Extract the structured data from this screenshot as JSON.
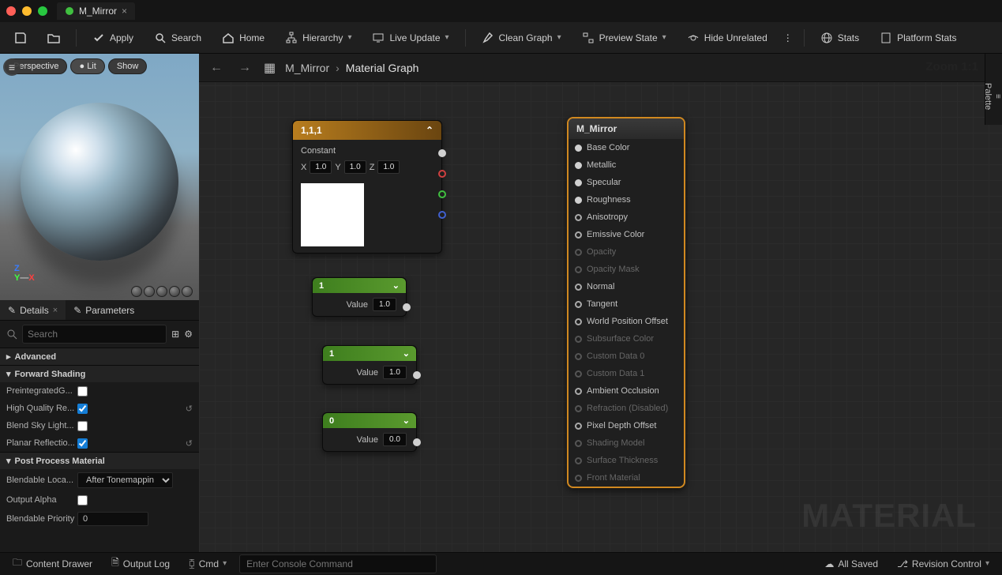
{
  "tab_title": "M_Mirror",
  "toolbar": {
    "apply": "Apply",
    "search": "Search",
    "home": "Home",
    "hierarchy": "Hierarchy",
    "live_update": "Live Update",
    "clean_graph": "Clean Graph",
    "preview_state": "Preview State",
    "hide_unrelated": "Hide Unrelated",
    "stats": "Stats",
    "platform_stats": "Platform Stats"
  },
  "preview": {
    "perspective": "Perspective",
    "lit": "Lit",
    "show": "Show",
    "axis_z": "Z",
    "axis_x": "X"
  },
  "details": {
    "tab_details": "Details",
    "tab_parameters": "Parameters",
    "search_placeholder": "Search",
    "cat_advanced": "Advanced",
    "cat_forward": "Forward Shading",
    "cat_postprocess": "Post Process Material",
    "props": {
      "preintegrated": "PreintegratedG...",
      "hq_reflections": "High Quality Re...",
      "blend_sky": "Blend Sky Light...",
      "planar_refl": "Planar Reflectio...",
      "blendable_loc": "Blendable Loca...",
      "blendable_loc_val": "After Tonemappin",
      "output_alpha": "Output Alpha",
      "blendable_priority": "Blendable Priority",
      "blendable_priority_val": "0"
    }
  },
  "graph": {
    "breadcrumb_root": "M_Mirror",
    "breadcrumb_current": "Material Graph",
    "zoom": "Zoom 1:1",
    "palette": "Palette",
    "watermark": "MATERIAL",
    "result": {
      "title": "M_Mirror",
      "pins": [
        {
          "label": "Base Color",
          "filled": true,
          "enabled": true
        },
        {
          "label": "Metallic",
          "filled": true,
          "enabled": true
        },
        {
          "label": "Specular",
          "filled": true,
          "enabled": true
        },
        {
          "label": "Roughness",
          "filled": true,
          "enabled": true
        },
        {
          "label": "Anisotropy",
          "filled": false,
          "enabled": true
        },
        {
          "label": "Emissive Color",
          "filled": false,
          "enabled": true
        },
        {
          "label": "Opacity",
          "filled": false,
          "enabled": false
        },
        {
          "label": "Opacity Mask",
          "filled": false,
          "enabled": false
        },
        {
          "label": "Normal",
          "filled": false,
          "enabled": true
        },
        {
          "label": "Tangent",
          "filled": false,
          "enabled": true
        },
        {
          "label": "World Position Offset",
          "filled": false,
          "enabled": true
        },
        {
          "label": "Subsurface Color",
          "filled": false,
          "enabled": false
        },
        {
          "label": "Custom Data 0",
          "filled": false,
          "enabled": false
        },
        {
          "label": "Custom Data 1",
          "filled": false,
          "enabled": false
        },
        {
          "label": "Ambient Occlusion",
          "filled": false,
          "enabled": true
        },
        {
          "label": "Refraction (Disabled)",
          "filled": false,
          "enabled": false
        },
        {
          "label": "Pixel Depth Offset",
          "filled": false,
          "enabled": true
        },
        {
          "label": "Shading Model",
          "filled": false,
          "enabled": false
        },
        {
          "label": "Surface Thickness",
          "filled": false,
          "enabled": false
        },
        {
          "label": "Front Material",
          "filled": false,
          "enabled": false
        }
      ]
    },
    "const_node": {
      "title": "1,1,1",
      "label": "Constant",
      "x": "1.0",
      "y": "1.0",
      "z": "1.0"
    },
    "scalar1": {
      "title": "1",
      "value_label": "Value",
      "value": "1.0"
    },
    "scalar2": {
      "title": "1",
      "value_label": "Value",
      "value": "1.0"
    },
    "scalar3": {
      "title": "0",
      "value_label": "Value",
      "value": "0.0"
    }
  },
  "status": {
    "content_drawer": "Content Drawer",
    "output_log": "Output Log",
    "cmd": "Cmd",
    "console_placeholder": "Enter Console Command",
    "all_saved": "All Saved",
    "revision": "Revision Control"
  }
}
